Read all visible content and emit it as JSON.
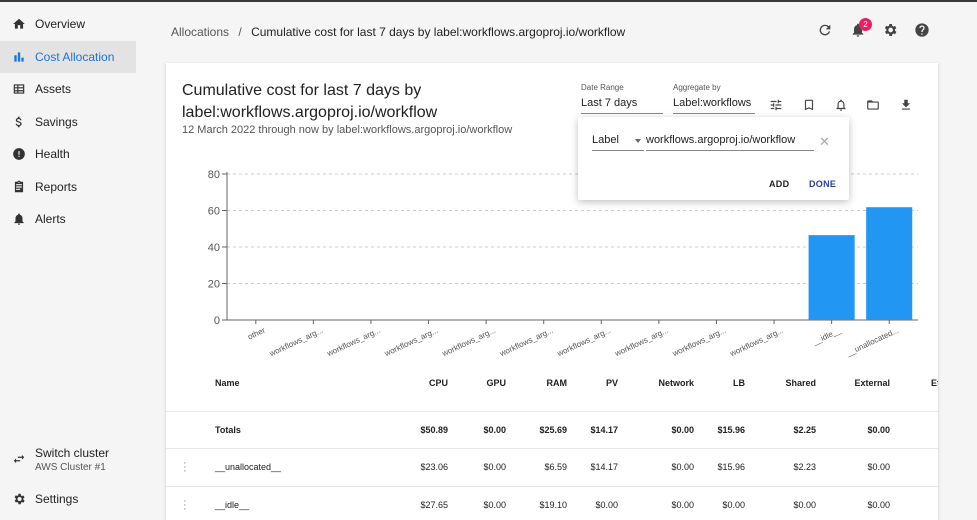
{
  "nav": {
    "items": [
      {
        "label": "Overview",
        "icon": "home-icon"
      },
      {
        "label": "Cost Allocation",
        "icon": "bar-chart-icon"
      },
      {
        "label": "Assets",
        "icon": "assets-icon"
      },
      {
        "label": "Savings",
        "icon": "dollar-icon"
      },
      {
        "label": "Health",
        "icon": "alert-circle-icon"
      },
      {
        "label": "Reports",
        "icon": "report-icon"
      },
      {
        "label": "Alerts",
        "icon": "bell-icon"
      }
    ],
    "active_index": 1,
    "switch_cluster": {
      "label": "Switch cluster",
      "cluster": "AWS Cluster #1"
    },
    "settings_label": "Settings"
  },
  "header": {
    "breadcrumb_root": "Allocations",
    "breadcrumb_sep": "/",
    "breadcrumb_current": "Cumulative cost for last 7 days by label:workflows.argoproj.io/workflow",
    "notification_count": "2"
  },
  "report": {
    "title": "Cumulative cost for last 7 days by label:workflows.argoproj.io/workflow",
    "subtitle": "12 March 2022 through now by label:workflows.argoproj.io/workflow",
    "date_range_label": "Date Range",
    "date_range_value": "Last 7 days",
    "aggregate_label": "Aggregate by",
    "aggregate_value": "Label:workflows"
  },
  "filter_popup": {
    "field": "Label",
    "value": "workflows.argoproj.io/workflow",
    "add_label": "ADD",
    "done_label": "DONE"
  },
  "chart_data": {
    "type": "bar",
    "categories": [
      "other",
      "workflows_arg...",
      "workflows_arg...",
      "workflows_arg...",
      "workflows_arg...",
      "workflows_arg...",
      "workflows_arg...",
      "workflows_arg...",
      "workflows_arg...",
      "workflows_arg...",
      "__idle__",
      "__unallocated..."
    ],
    "values": [
      0,
      0,
      0,
      0,
      0,
      0,
      0,
      0,
      0,
      0,
      46.5,
      61.8
    ],
    "y_ticks": [
      0,
      20,
      40,
      60,
      80
    ],
    "ylim": [
      0,
      80
    ],
    "bar_color": "#2196f3",
    "grid": true
  },
  "table": {
    "columns": [
      "Name",
      "CPU",
      "GPU",
      "RAM",
      "PV",
      "Network",
      "LB",
      "Shared",
      "External",
      "Ef"
    ],
    "totals": [
      "Totals",
      "$50.89",
      "$0.00",
      "$25.69",
      "$14.17",
      "$0.00",
      "$15.96",
      "$2.25",
      "$0.00"
    ],
    "rows": [
      [
        "__unallocated__",
        "$23.06",
        "$0.00",
        "$6.59",
        "$14.17",
        "$0.00",
        "$15.96",
        "$2.23",
        "$0.00"
      ],
      [
        "__idle__",
        "$27.65",
        "$0.00",
        "$19.10",
        "$0.00",
        "$0.00",
        "$0.00",
        "$0.00",
        "$0.00"
      ]
    ]
  },
  "colors": {
    "accent": "#1e73d9",
    "badge": "#e91e63",
    "done": "#2c3ea0"
  }
}
